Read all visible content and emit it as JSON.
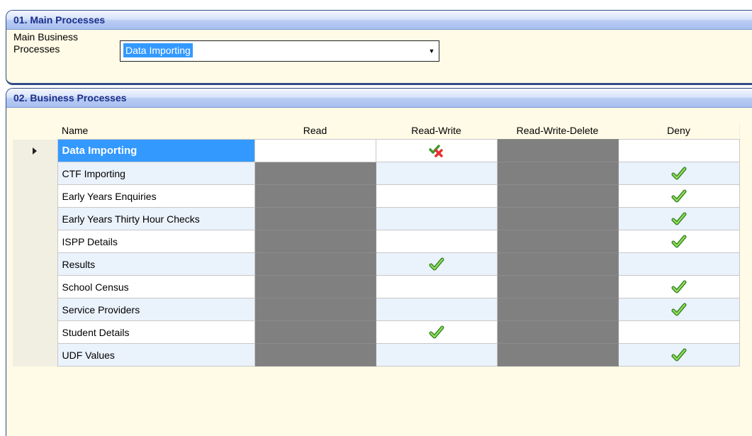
{
  "panel1": {
    "title": "01. Main Processes",
    "label": "Main Business Processes",
    "selected_value": "Data Importing"
  },
  "panel2": {
    "title": "02. Business Processes",
    "columns": [
      "Name",
      "Read",
      "Read-Write",
      "Read-Write-Delete",
      "Deny"
    ],
    "rows": [
      {
        "name": "Data Importing",
        "read": "empty",
        "read_write": "unset-icon",
        "rwd": "disabled",
        "deny": "empty",
        "selected": true
      },
      {
        "name": "CTF Importing",
        "read": "disabled",
        "read_write": "empty",
        "rwd": "disabled",
        "deny": "check-icon"
      },
      {
        "name": "Early Years Enquiries",
        "read": "disabled",
        "read_write": "empty",
        "rwd": "disabled",
        "deny": "check-icon"
      },
      {
        "name": "Early Years Thirty Hour Checks",
        "read": "disabled",
        "read_write": "empty",
        "rwd": "disabled",
        "deny": "check-icon"
      },
      {
        "name": "ISPP Details",
        "read": "disabled",
        "read_write": "empty",
        "rwd": "disabled",
        "deny": "check-icon"
      },
      {
        "name": "Results",
        "read": "disabled",
        "read_write": "check-icon",
        "rwd": "disabled",
        "deny": "empty"
      },
      {
        "name": "School Census",
        "read": "disabled",
        "read_write": "empty",
        "rwd": "disabled",
        "deny": "check-icon"
      },
      {
        "name": "Service Providers",
        "read": "disabled",
        "read_write": "empty",
        "rwd": "disabled",
        "deny": "check-icon"
      },
      {
        "name": "Student Details",
        "read": "disabled",
        "read_write": "check-icon",
        "rwd": "disabled",
        "deny": "empty"
      },
      {
        "name": "UDF Values",
        "read": "disabled",
        "read_write": "empty",
        "rwd": "disabled",
        "deny": "check-icon"
      }
    ]
  },
  "colors": {
    "panel_bg": "#fffbe6",
    "header_text": "#1b2f8a",
    "selection": "#3399ff",
    "disabled_cell": "#808080",
    "check": "#4caf30"
  }
}
